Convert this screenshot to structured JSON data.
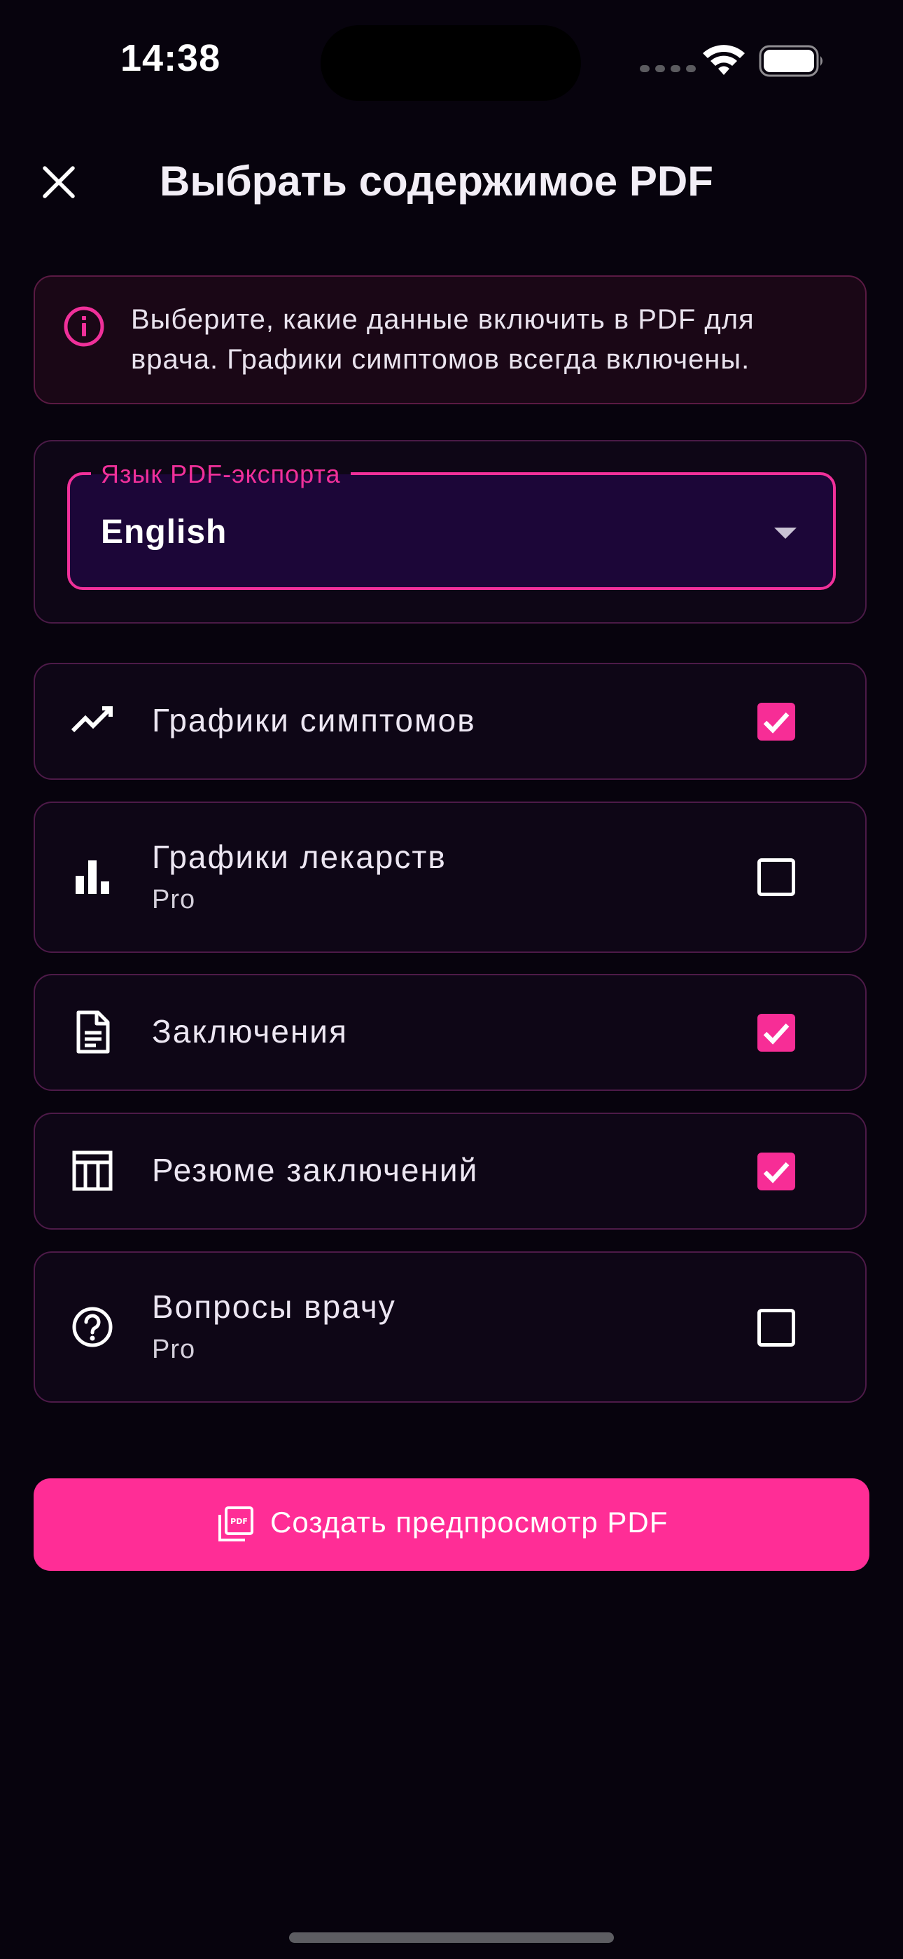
{
  "status_bar": {
    "time": "14:38"
  },
  "header": {
    "title": "Выбрать содержимое PDF",
    "close_icon": "close-icon"
  },
  "info_banner": {
    "icon": "info-icon",
    "text": "Выберите, какие данные включить в PDF для врача. Графики симптомов всегда включены."
  },
  "language": {
    "label": "Язык PDF-экспорта",
    "value": "English"
  },
  "options": [
    {
      "icon": "trending-line-icon",
      "label": "Графики симптомов",
      "sub": "",
      "checked": true
    },
    {
      "icon": "bar-chart-icon",
      "label": "Графики лекарств",
      "sub": "Pro",
      "checked": false
    },
    {
      "icon": "document-icon",
      "label": "Заключения",
      "sub": "",
      "checked": true
    },
    {
      "icon": "table-layout-icon",
      "label": "Резюме заключений",
      "sub": "",
      "checked": true
    },
    {
      "icon": "help-circle-icon",
      "label": "Вопросы врачу",
      "sub": "Pro",
      "checked": false
    }
  ],
  "primary_button": {
    "icon": "pdf-file-icon",
    "label": "Создать предпросмотр PDF"
  },
  "colors": {
    "accent": "#ff2d96",
    "background": "#07030d",
    "card_border": "#4d1a48",
    "field_fill": "#1c0638"
  }
}
